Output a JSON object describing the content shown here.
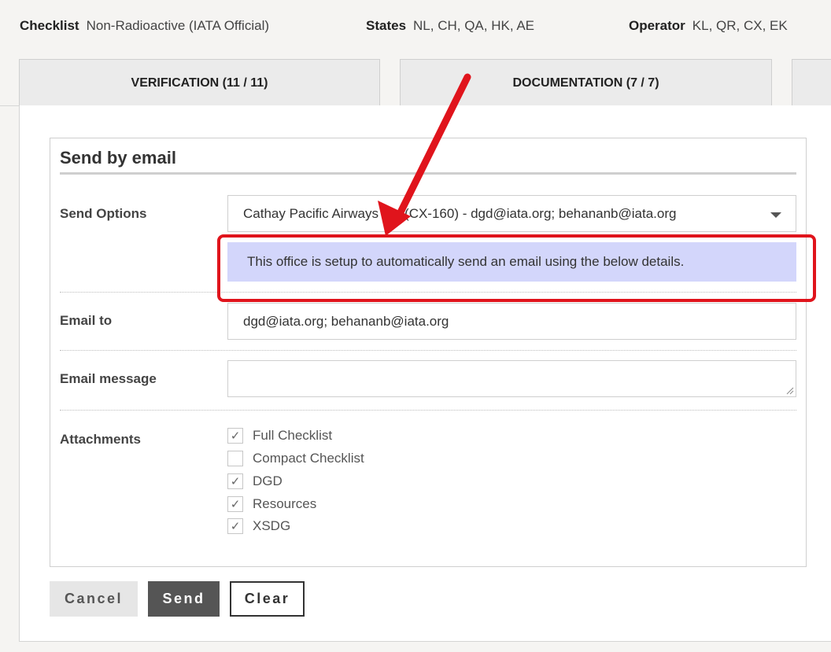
{
  "header": {
    "checklist_label": "Checklist",
    "checklist_value": "Non-Radioactive (IATA Official)",
    "states_label": "States",
    "states_value": "NL, CH, QA, HK, AE",
    "operator_label": "Operator",
    "operator_value": "KL, QR, CX, EK"
  },
  "tabs": [
    {
      "label": "VERIFICATION (11 / 11)"
    },
    {
      "label": "DOCUMENTATION (7 / 7)"
    },
    {
      "label": ""
    }
  ],
  "form": {
    "title": "Send by email",
    "send_options_label": "Send Options",
    "send_options_value": "Cathay Pacific Airways Ltd (CX-160) - dgd@iata.org; behananb@iata.org",
    "info_message": "This office is setup to automatically send an email using the below details.",
    "email_to_label": "Email to",
    "email_to_value": "dgd@iata.org; behananb@iata.org",
    "email_message_label": "Email message",
    "email_message_value": "",
    "attachments_label": "Attachments",
    "attachments": [
      {
        "label": "Full Checklist",
        "checked": true
      },
      {
        "label": "Compact Checklist",
        "checked": false
      },
      {
        "label": "DGD",
        "checked": true
      },
      {
        "label": "Resources",
        "checked": true
      },
      {
        "label": "XSDG",
        "checked": true
      }
    ]
  },
  "buttons": {
    "cancel": "Cancel",
    "send": "Send",
    "clear": "Clear"
  },
  "annotation": {
    "color": "#e0141c"
  },
  "icons": {
    "check": "✓",
    "dropdown": "chevron-down-icon"
  }
}
